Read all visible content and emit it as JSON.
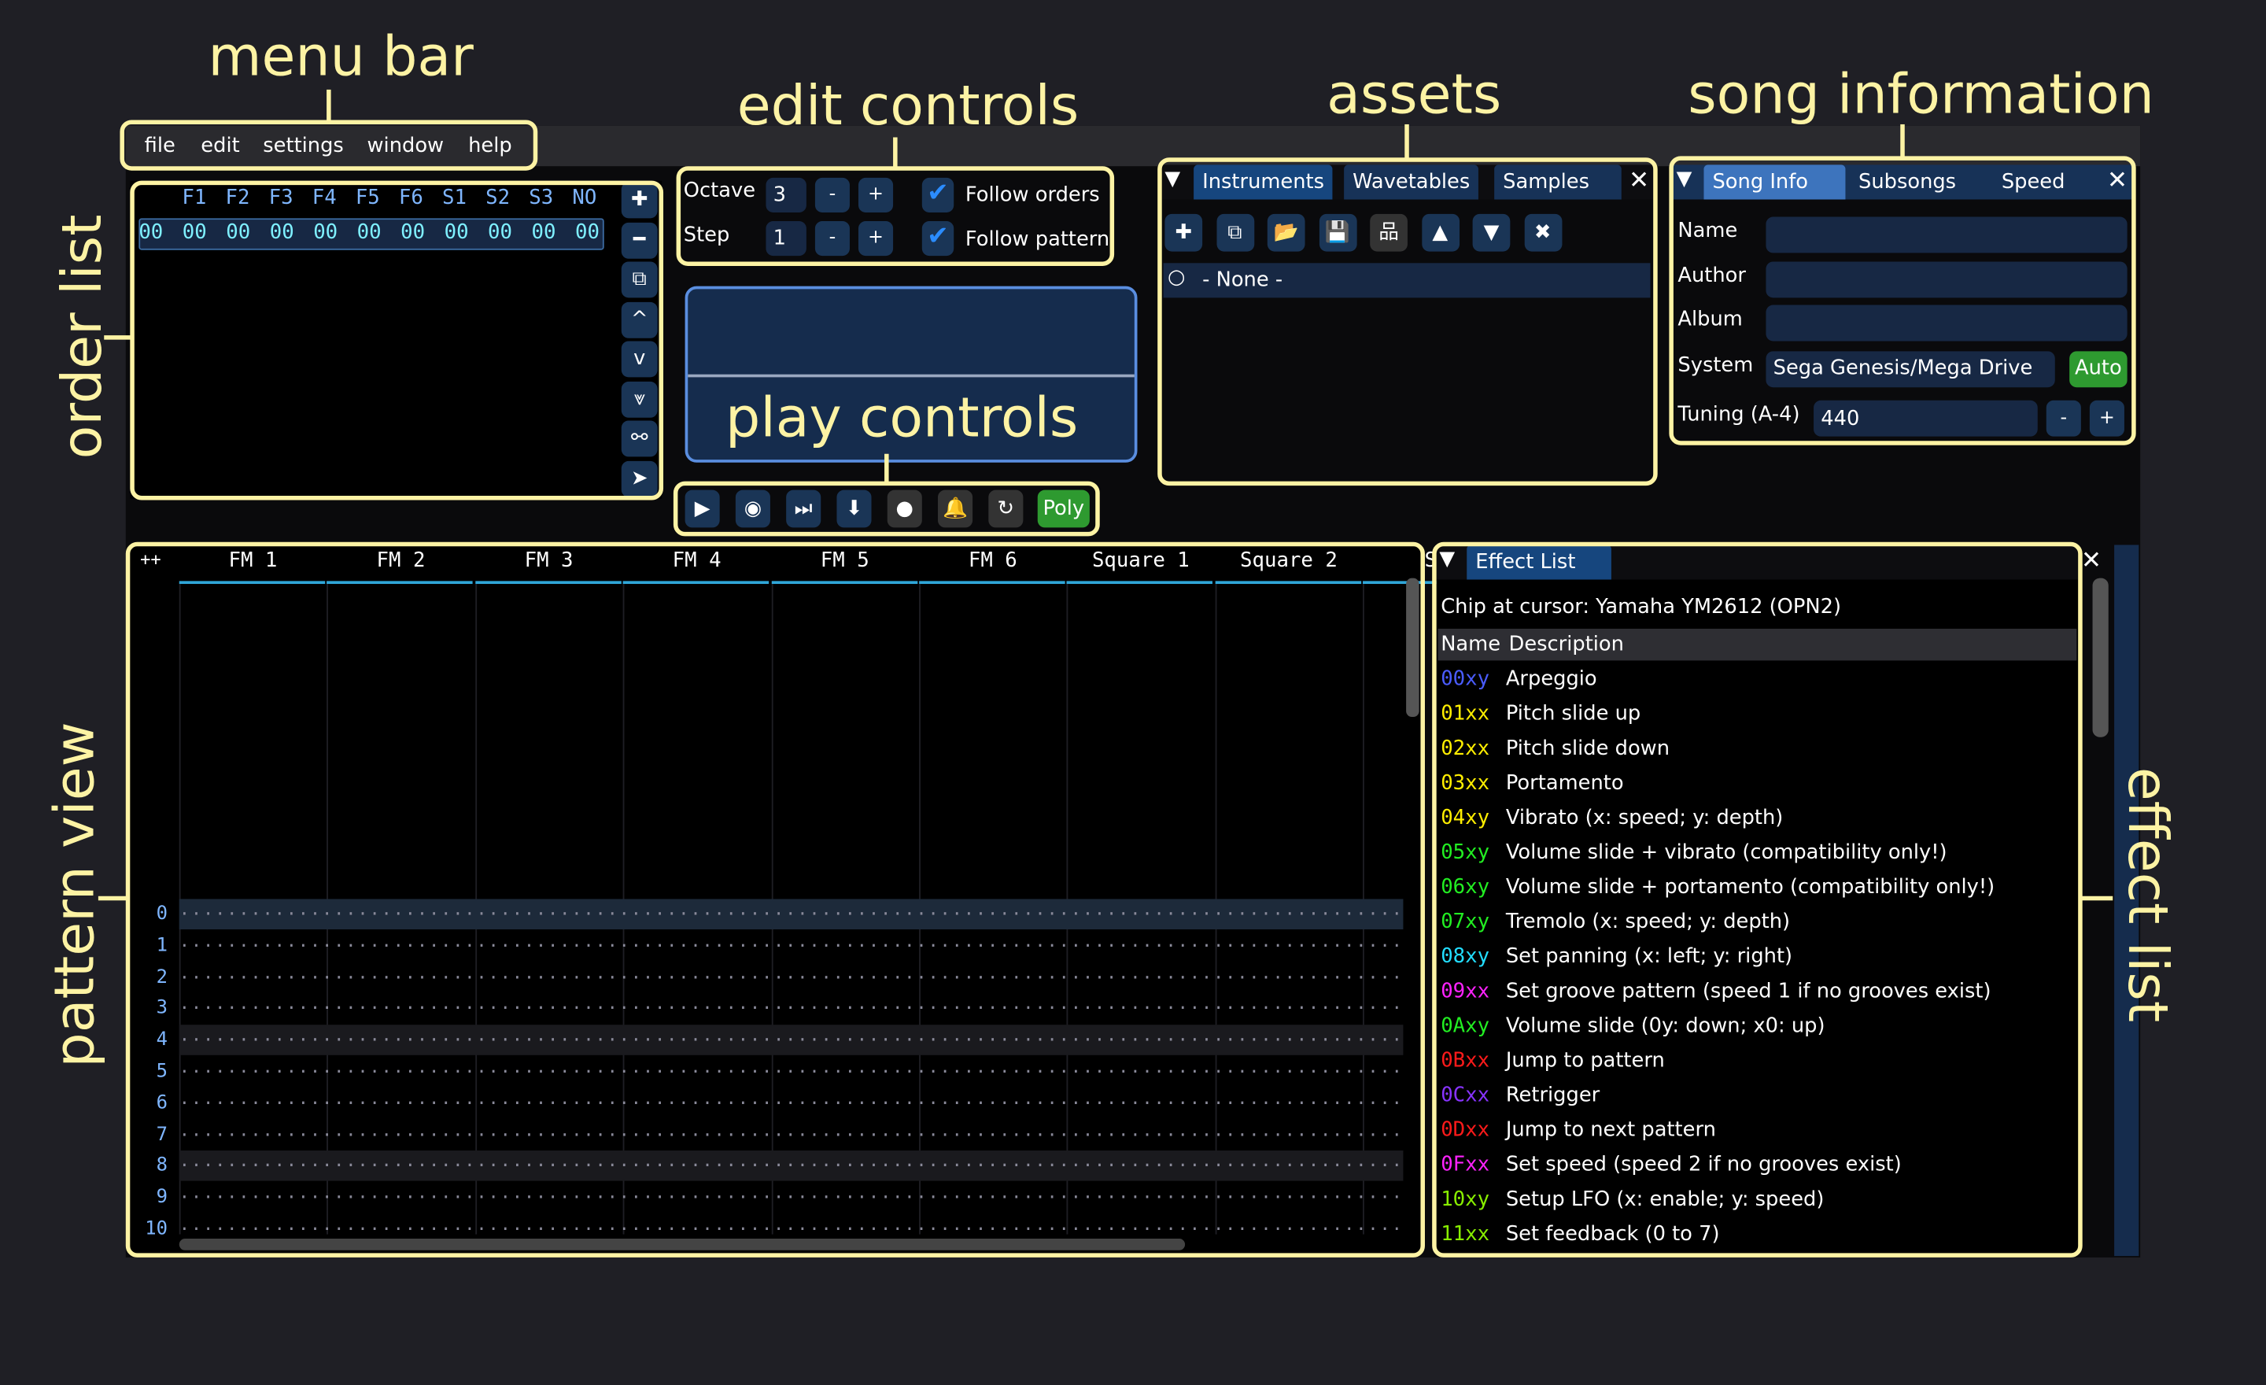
{
  "annotations": {
    "menu_bar": "menu bar",
    "edit_controls": "edit controls",
    "assets": "assets",
    "song_information": "song information",
    "order_list": "order list",
    "play_controls": "play controls",
    "pattern_view": "pattern view",
    "effect_list": "effect list"
  },
  "menu": [
    "file",
    "edit",
    "settings",
    "window",
    "help"
  ],
  "order_list": {
    "headers": [
      "F1",
      "F2",
      "F3",
      "F4",
      "F5",
      "F6",
      "S1",
      "S2",
      "S3",
      "NO"
    ],
    "row": [
      "00",
      "00",
      "00",
      "00",
      "00",
      "00",
      "00",
      "00",
      "00",
      "00",
      "00"
    ],
    "buttons": [
      "plus-icon",
      "minus-icon",
      "duplicate-icon",
      "move-up-icon",
      "move-down-icon",
      "move-down-double-icon",
      "unlink-icon",
      "cursor-icon"
    ]
  },
  "edit_controls": {
    "octave_label": "Octave",
    "octave_value": "3",
    "step_label": "Step",
    "step_value": "1",
    "minus": "-",
    "plus": "+",
    "follow_orders": "Follow orders",
    "follow_pattern": "Follow pattern",
    "follow_orders_checked": true,
    "follow_pattern_checked": true
  },
  "play_controls": {
    "buttons": [
      "play-icon",
      "play-pattern-icon",
      "step-icon",
      "stop-down-icon",
      "record-icon",
      "metronome-icon",
      "repeat-icon"
    ],
    "poly": "Poly"
  },
  "assets": {
    "tabs": [
      "Instruments",
      "Wavetables",
      "Samples"
    ],
    "toolbar": [
      "add-icon",
      "duplicate-icon",
      "open-icon",
      "save-icon",
      "hierarchy-icon",
      "up-icon",
      "down-icon",
      "delete-icon"
    ],
    "items": [
      "- None -"
    ]
  },
  "song_info": {
    "tabs": [
      "Song Info",
      "Subsongs",
      "Speed"
    ],
    "name_label": "Name",
    "name": "",
    "author_label": "Author",
    "author": "",
    "album_label": "Album",
    "album": "",
    "system_label": "System",
    "system": "Sega Genesis/Mega Drive",
    "auto": "Auto",
    "tuning_label": "Tuning (A-4)",
    "tuning": "440",
    "minus": "-",
    "plus": "+"
  },
  "pattern": {
    "corner": "++",
    "channels": [
      "FM 1",
      "FM 2",
      "FM 3",
      "FM 4",
      "FM 5",
      "FM 6",
      "Square 1",
      "Square 2",
      "Sq"
    ],
    "rows": [
      "0",
      "1",
      "2",
      "3",
      "4",
      "5",
      "6",
      "7",
      "8",
      "9",
      "10"
    ]
  },
  "effect_list": {
    "tab": "Effect List",
    "chip": "Chip at cursor: Yamaha YM2612 (OPN2)",
    "col_name": "Name",
    "col_desc": "Description",
    "effects": [
      {
        "code": "00xy",
        "desc": "Arpeggio",
        "color": "#4a5cff"
      },
      {
        "code": "01xx",
        "desc": "Pitch slide up",
        "color": "#ffee00"
      },
      {
        "code": "02xx",
        "desc": "Pitch slide down",
        "color": "#ffee00"
      },
      {
        "code": "03xx",
        "desc": "Portamento",
        "color": "#ffee00"
      },
      {
        "code": "04xy",
        "desc": "Vibrato (x: speed; y: depth)",
        "color": "#ffee00"
      },
      {
        "code": "05xy",
        "desc": "Volume slide + vibrato (compatibility only!)",
        "color": "#22ee22"
      },
      {
        "code": "06xy",
        "desc": "Volume slide + portamento (compatibility only!)",
        "color": "#22ee22"
      },
      {
        "code": "07xy",
        "desc": "Tremolo (x: speed; y: depth)",
        "color": "#22ee22"
      },
      {
        "code": "08xy",
        "desc": "Set panning (x: left; y: right)",
        "color": "#22ddff"
      },
      {
        "code": "09xx",
        "desc": "Set groove pattern (speed 1 if no grooves exist)",
        "color": "#ff22ff"
      },
      {
        "code": "0Axy",
        "desc": "Volume slide (0y: down; x0: up)",
        "color": "#22ee22"
      },
      {
        "code": "0Bxx",
        "desc": "Jump to pattern",
        "color": "#ff1a1a"
      },
      {
        "code": "0Cxx",
        "desc": "Retrigger",
        "color": "#8833ff"
      },
      {
        "code": "0Dxx",
        "desc": "Jump to next pattern",
        "color": "#ff1a1a"
      },
      {
        "code": "0Fxx",
        "desc": "Set speed (speed 2 if no grooves exist)",
        "color": "#ff22ff"
      },
      {
        "code": "10xy",
        "desc": "Setup LFO (x: enable; y: speed)",
        "color": "#88ee00"
      },
      {
        "code": "11xx",
        "desc": "Set feedback (0 to 7)",
        "color": "#88ee00"
      }
    ]
  },
  "colors": {
    "annotation": "#fdf3a4",
    "accent": "#1a3556",
    "tab_active": "#3d74bd",
    "green": "#2e9a30",
    "header_blue": "#7fb6ff",
    "order_cyan": "#7ff0ff"
  }
}
